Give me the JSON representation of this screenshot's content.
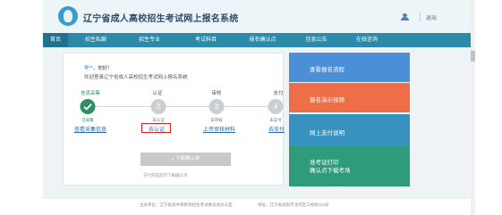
{
  "header": {
    "title": "辽宁省成人高校招生考试网上报名系统",
    "logout_label": "退出"
  },
  "nav": [
    {
      "label": "首页"
    },
    {
      "label": "招生私聊"
    },
    {
      "label": "招生专业"
    },
    {
      "label": "考试科目"
    },
    {
      "label": "报名确认点"
    },
    {
      "label": "信息公告"
    },
    {
      "label": "在线咨询"
    }
  ],
  "welcome": {
    "name": "李**",
    "greeting": "，你好！",
    "message": "欢迎登录辽宁省成人高校招生考试网上报名系统"
  },
  "steps": [
    {
      "title": "信息采集",
      "number": "",
      "status": "已采集",
      "link": "查看采集信息"
    },
    {
      "title": "认证",
      "number": "2",
      "status": "未认证",
      "link": "去认证"
    },
    {
      "title": "审核",
      "number": "3",
      "status": "未审核",
      "link": "上传审核材料"
    },
    {
      "title": "支付",
      "number": "4",
      "status": "未支付",
      "link": "去支付"
    }
  ],
  "download": {
    "button_label": "下载确认单",
    "tip": "支付完成后可下载确认单"
  },
  "side_panels": [
    {
      "label": "查看报名流程"
    },
    {
      "label": "报名演示视频"
    },
    {
      "label": "网上支付说明"
    },
    {
      "label": "准考证打印\n确认点下载考场"
    }
  ],
  "footer": {
    "org": "主办单位：辽宁省高中等教育招生考试委员会办公室",
    "address": "地址：辽宁省沈阳市沈河区三经街103号"
  },
  "colors": {
    "nav_bg": "#2b8aa7",
    "success": "#2f8d68",
    "highlight_border": "#d42222",
    "panel_blue": "#4b8fd6",
    "panel_orange": "#ee6f47",
    "panel_cyan": "#3792c0",
    "panel_green": "#2e9c7a"
  }
}
